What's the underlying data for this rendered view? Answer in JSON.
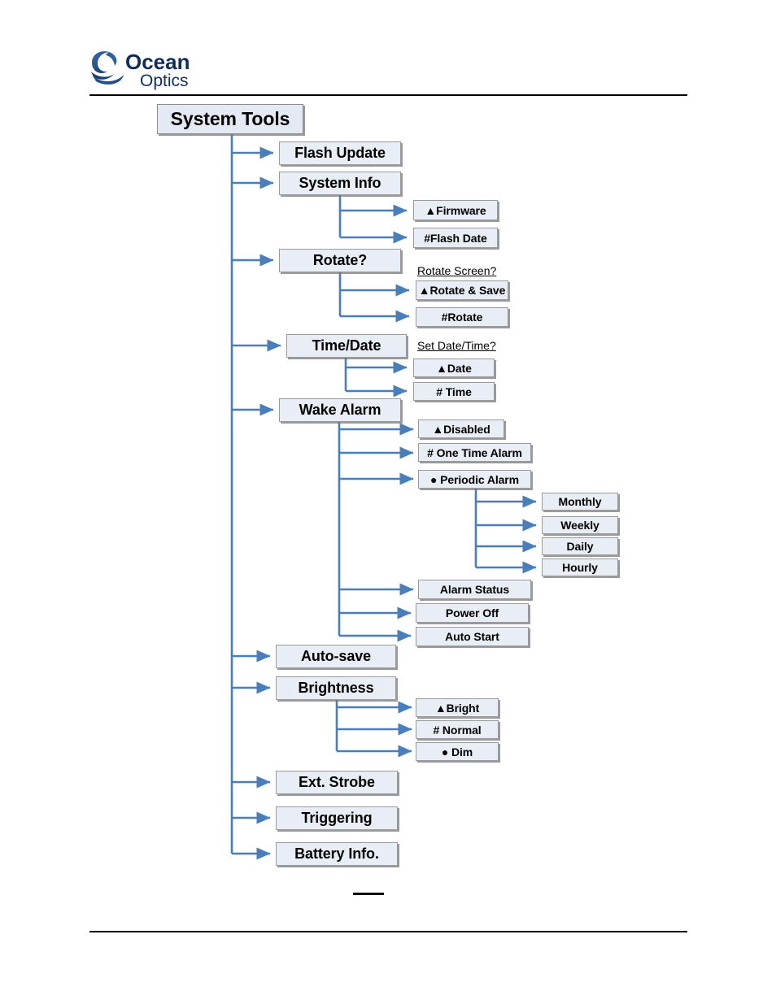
{
  "document": {
    "brand": {
      "name_top": "Ocean",
      "name_bottom": "Optics",
      "logo_icon": "ocean-optics-swirl-logo",
      "color_dark": "#1b3f7a",
      "color_mid": "#2b5ea8"
    },
    "page_mark": "—"
  },
  "diagram": {
    "title": "System Tools",
    "accent_color": "#4a7ebb",
    "box_fill": "#e9edf5",
    "box_border": "#9a9a9a",
    "root": {
      "label": "System Tools"
    },
    "level1": [
      {
        "label": "Flash Update"
      },
      {
        "label": "System Info"
      },
      {
        "label": "Rotate?"
      },
      {
        "label": "Time/Date"
      },
      {
        "label": "Wake Alarm"
      },
      {
        "label": "Auto-save"
      },
      {
        "label": "Brightness"
      },
      {
        "label": "Ext. Strobe"
      },
      {
        "label": "Triggering"
      },
      {
        "label": "Battery Info."
      }
    ],
    "system_info_children": [
      {
        "label": "▲Firmware"
      },
      {
        "label": "#Flash Date"
      }
    ],
    "rotate_caption": "Rotate Screen?",
    "rotate_children": [
      {
        "label": "▲Rotate & Save"
      },
      {
        "label": "#Rotate"
      }
    ],
    "time_date_caption": "Set Date/Time?",
    "time_date_children": [
      {
        "label": "▲Date"
      },
      {
        "label": "# Time"
      }
    ],
    "wake_alarm_children": [
      {
        "label": "▲Disabled"
      },
      {
        "label": "# One Time Alarm"
      },
      {
        "label": "● Periodic Alarm"
      },
      {
        "label": "Alarm Status"
      },
      {
        "label": "Power Off"
      },
      {
        "label": "Auto Start"
      }
    ],
    "periodic_alarm_children": [
      {
        "label": "Monthly"
      },
      {
        "label": "Weekly"
      },
      {
        "label": "Daily"
      },
      {
        "label": "Hourly"
      }
    ],
    "brightness_children": [
      {
        "label": "▲Bright"
      },
      {
        "label": "# Normal"
      },
      {
        "label": "● Dim"
      }
    ]
  }
}
